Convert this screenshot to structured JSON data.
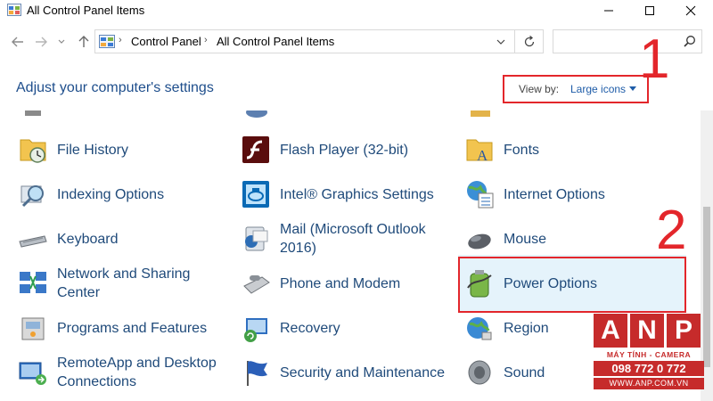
{
  "window": {
    "title": "All Control Panel Items"
  },
  "address": {
    "crumbs": [
      "Control Panel",
      "All Control Panel Items"
    ],
    "search_placeholder": ""
  },
  "header": {
    "heading": "Adjust your computer's settings",
    "view_by_label": "View by:",
    "view_by_value": "Large icons"
  },
  "annotations": {
    "one": "1",
    "two": "2",
    "highlight_color": "#e3262b"
  },
  "items": [
    {
      "label": "File History",
      "icon": "file-history-icon"
    },
    {
      "label": "Flash Player (32-bit)",
      "icon": "flash-player-icon"
    },
    {
      "label": "Fonts",
      "icon": "fonts-icon"
    },
    {
      "label": "Indexing Options",
      "icon": "indexing-options-icon"
    },
    {
      "label": "Intel® Graphics Settings",
      "icon": "intel-graphics-icon"
    },
    {
      "label": "Internet Options",
      "icon": "internet-options-icon"
    },
    {
      "label": "Keyboard",
      "icon": "keyboard-icon"
    },
    {
      "label": "Mail (Microsoft Outlook",
      "label2": "2016)",
      "icon": "mail-icon"
    },
    {
      "label": "Mouse",
      "icon": "mouse-icon"
    },
    {
      "label": "Network and Sharing",
      "label2": "Center",
      "icon": "network-sharing-icon"
    },
    {
      "label": "Phone and Modem",
      "icon": "phone-modem-icon"
    },
    {
      "label": "Power Options",
      "icon": "power-options-icon"
    },
    {
      "label": "Programs and Features",
      "icon": "programs-features-icon"
    },
    {
      "label": "Recovery",
      "icon": "recovery-icon"
    },
    {
      "label": "Region",
      "icon": "region-icon"
    },
    {
      "label": "RemoteApp and Desktop",
      "label2": "Connections",
      "icon": "remoteapp-icon"
    },
    {
      "label": "Security and Maintenance",
      "icon": "security-maintenance-icon"
    },
    {
      "label": "Sound",
      "icon": "sound-icon"
    }
  ],
  "watermark": {
    "letters": [
      "A",
      "N",
      "P"
    ],
    "tagline": "MÁY TÍNH - CAMERA",
    "phone": "098 772 0 772",
    "website": "WWW.ANP.COM.VN",
    "brand_color": "#c62b2b"
  }
}
